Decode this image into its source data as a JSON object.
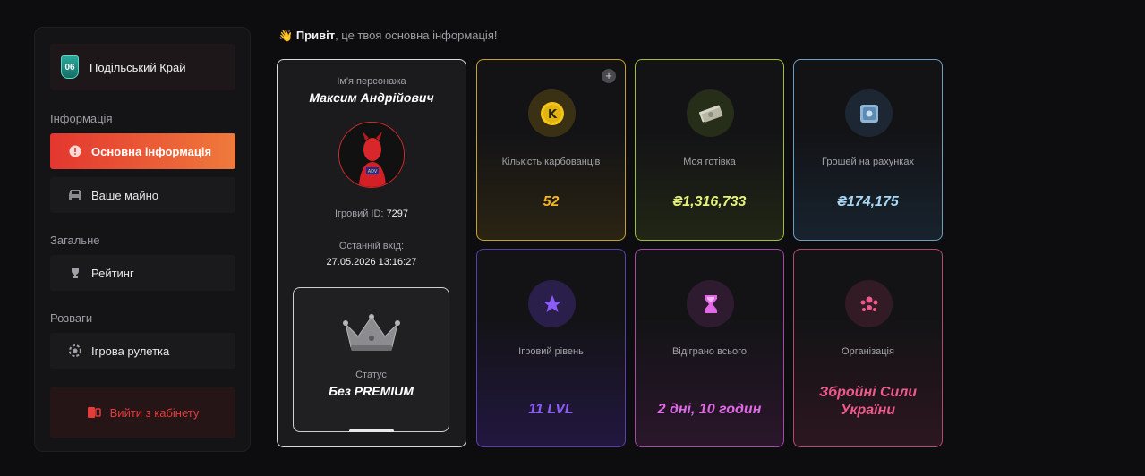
{
  "sidebar": {
    "server": {
      "badge": "06",
      "name": "Подільський Край"
    },
    "sections": {
      "info": "Інформація",
      "general": "Загальне",
      "fun": "Розваги"
    },
    "items": [
      {
        "label": "Основна інформація",
        "icon": "alert-circle-icon"
      },
      {
        "label": "Ваше майно",
        "icon": "car-icon"
      },
      {
        "label": "Рейтинг",
        "icon": "trophy-icon"
      },
      {
        "label": "Ігрова рулетка",
        "icon": "roulette-icon"
      }
    ],
    "logout": "Вийти з кабінету"
  },
  "header": {
    "wave": "👋",
    "hello": "Привіт",
    "rest": ", це твоя основна інформація!"
  },
  "profile": {
    "name_label": "Ім'я персонажа",
    "name": "Максим Андрійович",
    "id_label": "Ігровий ID:",
    "id_value": "7297",
    "last_login_label": "Останній вхід:",
    "last_login_value": "27.05.2026 13:16:27",
    "status_label": "Статус",
    "status_value": "Без PREMIUM"
  },
  "stats": [
    {
      "label": "Кількість карбованців",
      "value": "52",
      "icon": "coin-k-icon",
      "color": "#f2b624"
    },
    {
      "label": "Моя готівка",
      "value": "₴1,316,733",
      "icon": "cash-icon",
      "color": "#e6f27a"
    },
    {
      "label": "Грошей на рахунках",
      "value": "₴174,175",
      "icon": "safe-icon",
      "color": "#a9d8f5"
    },
    {
      "label": "Ігровий рівень",
      "value": "11 LVL",
      "icon": "star-icon",
      "color": "#8b5cf6"
    },
    {
      "label": "Відіграно всього",
      "value": "2 дні, 10 годин",
      "icon": "hourglass-icon",
      "color": "#e069e6"
    },
    {
      "label": "Організація",
      "value": "Збройні Сили України",
      "icon": "group-icon",
      "color": "#ee5b8a"
    }
  ],
  "add_symbol": "+"
}
